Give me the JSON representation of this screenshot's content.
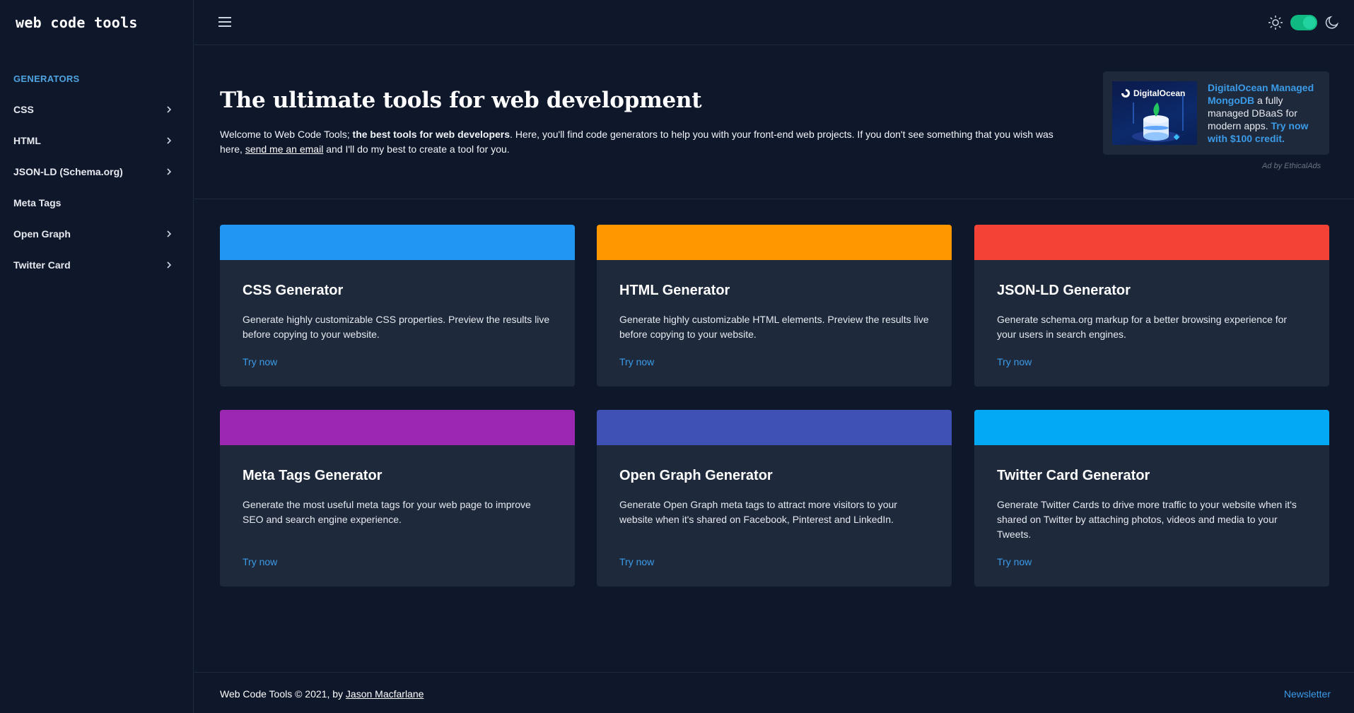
{
  "app": {
    "logo": "web code tools"
  },
  "sidebar": {
    "heading": "GENERATORS",
    "items": [
      {
        "label": "CSS",
        "has_submenu": true
      },
      {
        "label": "HTML",
        "has_submenu": true
      },
      {
        "label": "JSON-LD (Schema.org)",
        "has_submenu": true
      },
      {
        "label": "Meta Tags",
        "has_submenu": false
      },
      {
        "label": "Open Graph",
        "has_submenu": true
      },
      {
        "label": "Twitter Card",
        "has_submenu": true
      }
    ]
  },
  "header": {
    "menu_icon": "hamburger-icon",
    "light_icon": "sun-icon",
    "dark_icon": "moon-icon",
    "theme_toggle_on": true
  },
  "hero": {
    "title": "The ultimate tools for web development",
    "text_part1": "Welcome to Web Code Tools; ",
    "text_bold": "the best tools for web developers",
    "text_part2": ". Here, you'll find code generators to help you with your front-end web projects. If you don't see something that you wish was here, ",
    "email_link": "send me an email",
    "text_part3": " and I'll do my best to create a tool for you."
  },
  "ad": {
    "brand": "DigitalOcean",
    "headline_link": "DigitalOcean Managed MongoDB",
    "body": " a fully managed DBaaS for modern apps. ",
    "cta_link": "Try now with $100 credit.",
    "attribution": "Ad by EthicalAds"
  },
  "cards": [
    {
      "title": "CSS Generator",
      "description": "Generate highly customizable CSS properties. Preview the results live before copying to your website.",
      "link": "Try now",
      "color": "#2196f3"
    },
    {
      "title": "HTML Generator",
      "description": "Generate highly customizable HTML elements. Preview the results live before copying to your website.",
      "link": "Try now",
      "color": "#ff9800"
    },
    {
      "title": "JSON-LD Generator",
      "description": "Generate schema.org markup for a better browsing experience for your users in search engines.",
      "link": "Try now",
      "color": "#f44336"
    },
    {
      "title": "Meta Tags Generator",
      "description": "Generate the most useful meta tags for your web page to improve SEO and search engine experience.",
      "link": "Try now",
      "color": "#9c27b0"
    },
    {
      "title": "Open Graph Generator",
      "description": "Generate Open Graph meta tags to attract more visitors to your website when it's shared on Facebook, Pinterest and LinkedIn.",
      "link": "Try now",
      "color": "#3f51b5"
    },
    {
      "title": "Twitter Card Generator",
      "description": "Generate Twitter Cards to drive more traffic to your website when it's shared on Twitter by attaching photos, videos and media to your Tweets.",
      "link": "Try now",
      "color": "#03a9f4"
    }
  ],
  "footer": {
    "copyright": "Web Code Tools © 2021, by ",
    "author_link": "Jason Macfarlane",
    "newsletter": "Newsletter"
  }
}
